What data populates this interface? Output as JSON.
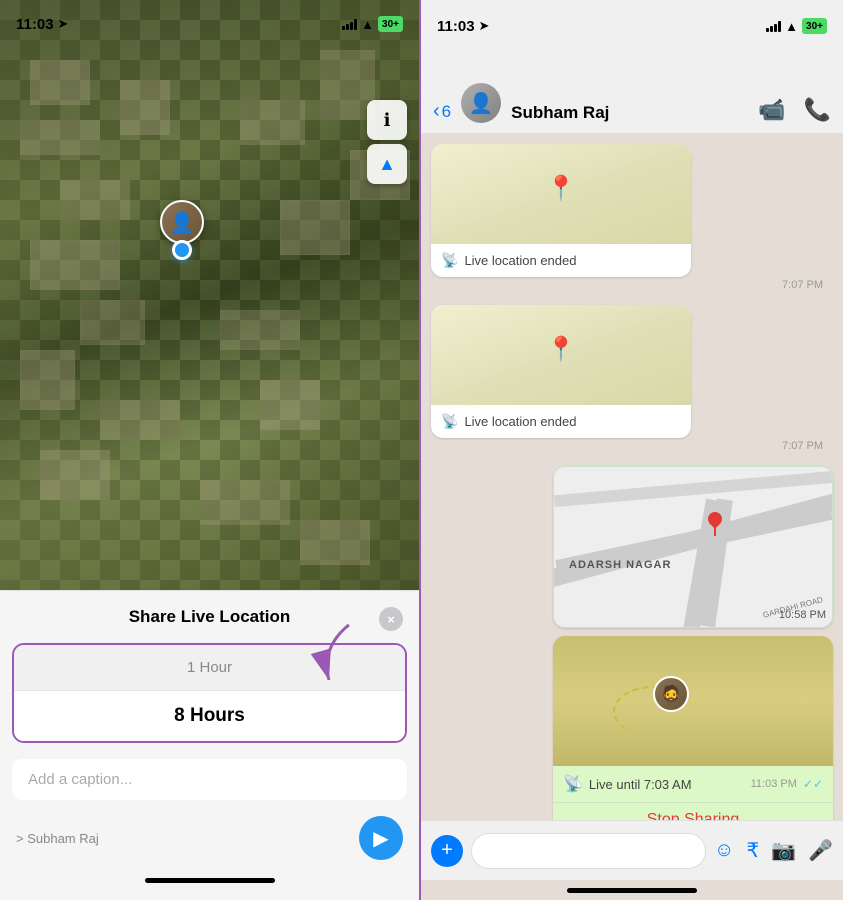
{
  "left": {
    "status": {
      "time": "11:03",
      "battery": "30+"
    },
    "map_controls": {
      "info_btn": "ℹ",
      "locate_btn": "➤"
    },
    "bottom_sheet": {
      "title": "Share Live Location",
      "close_label": "×",
      "durations": [
        {
          "label": "1 Hour",
          "selected": false
        },
        {
          "label": "8 Hours",
          "selected": true
        },
        {
          "label": "8 Hours",
          "selected": false
        }
      ],
      "caption_placeholder": "Add a caption...",
      "recipient_label": "> Subham Raj",
      "send_icon": "➤"
    }
  },
  "right": {
    "status": {
      "time": "11:03"
    },
    "header": {
      "back_count": "6",
      "contact_name": "Subham Raj",
      "video_icon": "📹",
      "phone_icon": "📞"
    },
    "messages": [
      {
        "type": "location_ended",
        "text": "Live location ended",
        "time": "7:07 PM"
      },
      {
        "type": "location_ended",
        "text": "Live location ended",
        "time": "7:07 PM"
      },
      {
        "type": "map_pin",
        "area": "ADARSH NAGAR",
        "road": "GARDAHI ROAD",
        "time": "10:58 PM"
      },
      {
        "type": "live_location",
        "live_text": "Live until 7:03 AM",
        "time": "11:03 PM",
        "stop_sharing": "Stop Sharing"
      }
    ],
    "input": {
      "add_icon": "+",
      "sticker_icon": "☺",
      "rupee_icon": "₹",
      "camera_icon": "📷",
      "mic_icon": "🎤"
    }
  }
}
